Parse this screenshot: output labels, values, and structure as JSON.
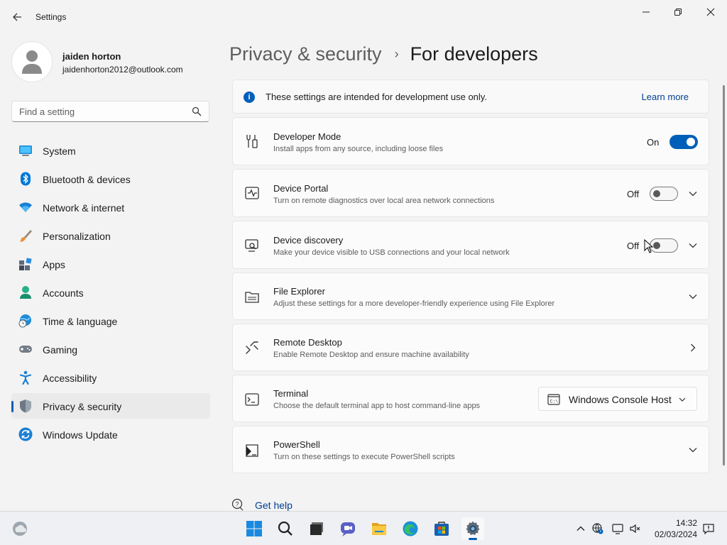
{
  "window": {
    "app_title": "Settings",
    "back_icon": "back-arrow-icon",
    "controls": [
      "minimize-icon",
      "maximize-icon",
      "close-icon"
    ]
  },
  "user": {
    "name": "jaiden horton",
    "email": "jaidenhorton2012@outlook.com"
  },
  "search": {
    "placeholder": "Find a setting",
    "value": ""
  },
  "sidebar": {
    "items": [
      {
        "label": "System",
        "icon": "system-icon"
      },
      {
        "label": "Bluetooth & devices",
        "icon": "bluetooth-icon"
      },
      {
        "label": "Network & internet",
        "icon": "wifi-icon"
      },
      {
        "label": "Personalization",
        "icon": "paintbrush-icon"
      },
      {
        "label": "Apps",
        "icon": "apps-icon"
      },
      {
        "label": "Accounts",
        "icon": "accounts-icon"
      },
      {
        "label": "Time & language",
        "icon": "globe-clock-icon"
      },
      {
        "label": "Gaming",
        "icon": "gamepad-icon"
      },
      {
        "label": "Accessibility",
        "icon": "accessibility-icon"
      },
      {
        "label": "Privacy & security",
        "icon": "shield-icon",
        "active": true
      },
      {
        "label": "Windows Update",
        "icon": "windows-update-icon"
      }
    ]
  },
  "breadcrumb": {
    "parent": "Privacy & security",
    "separator": "›",
    "current": "For developers"
  },
  "info": {
    "text": "These settings are intended for development use only.",
    "link": "Learn more"
  },
  "settings": {
    "developer_mode": {
      "title": "Developer Mode",
      "desc": "Install apps from any source, including loose files",
      "state": "On",
      "on": true
    },
    "device_portal": {
      "title": "Device Portal",
      "desc": "Turn on remote diagnostics over local area network connections",
      "state": "Off",
      "on": false
    },
    "device_discovery": {
      "title": "Device discovery",
      "desc": "Make your device visible to USB connections and your local network",
      "state": "Off",
      "on": false
    },
    "file_explorer": {
      "title": "File Explorer",
      "desc": "Adjust these settings for a more developer-friendly experience using File Explorer"
    },
    "remote_desktop": {
      "title": "Remote Desktop",
      "desc": "Enable Remote Desktop and ensure machine availability"
    },
    "terminal": {
      "title": "Terminal",
      "desc": "Choose the default terminal app to host command-line apps",
      "selected": "Windows Console Host"
    },
    "powershell": {
      "title": "PowerShell",
      "desc": "Turn on these settings to execute PowerShell scripts"
    }
  },
  "help": {
    "label": "Get help"
  },
  "taskbar": {
    "apps": [
      "weather-icon",
      "start-icon",
      "search-icon",
      "task-view-icon",
      "chat-icon",
      "file-explorer-icon",
      "edge-icon",
      "store-icon",
      "settings-icon"
    ],
    "tray": [
      "chevron-up-icon",
      "network-icon",
      "display-icon",
      "volume-icon",
      "notification-icon"
    ],
    "time": "14:32",
    "date": "02/03/2024"
  },
  "colors": {
    "accent": "#005fb8",
    "link": "#003e92",
    "background": "#f3f3f3",
    "card": "#fbfbfb"
  }
}
